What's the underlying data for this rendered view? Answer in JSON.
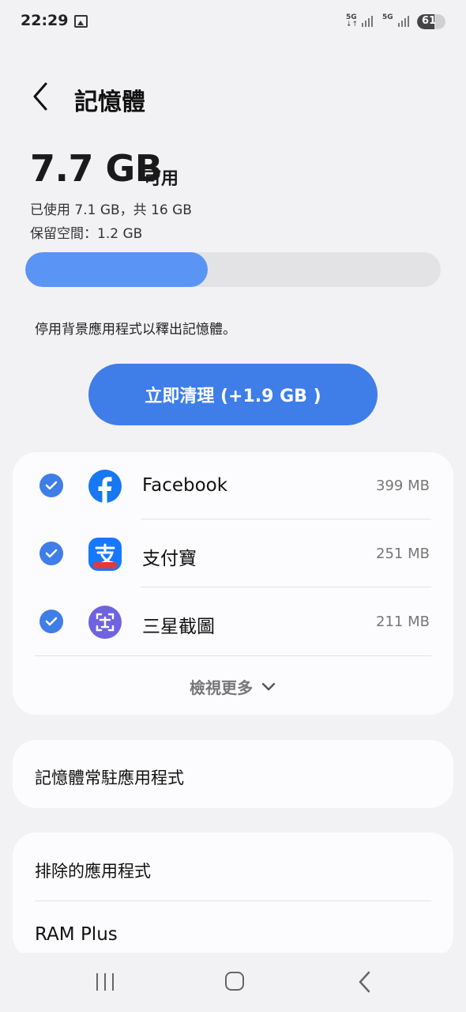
{
  "status_bar": {
    "time": "22:29",
    "network1": "5G",
    "network1_arrows": "↓↑",
    "network2": "5G",
    "battery": "61",
    "battery_level": 0.61,
    "icons": [
      "image-icon",
      "signal-icon",
      "signal-icon",
      "battery-icon"
    ]
  },
  "header": {
    "back_icon": "back-chevron-icon",
    "title": "記憶體"
  },
  "memory": {
    "available_value": "7.7 GB",
    "available_label": "可用",
    "used_text": "已使用 7.1 GB，共 16 GB",
    "reserved_text": "保留空間：1.2 GB",
    "used_fraction": 0.44,
    "hint": "停用背景應用程式以釋出記憶體。",
    "clean_button": "立即清理 (+1.9 GB )"
  },
  "apps": [
    {
      "name": "Facebook",
      "size": "399 MB",
      "checked": true,
      "icon": "facebook-icon"
    },
    {
      "name": "支付寶",
      "size": "251 MB",
      "checked": true,
      "icon": "alipay-icon"
    },
    {
      "name": "三星截圖",
      "size": "211 MB",
      "checked": true,
      "icon": "samsung-capture-icon"
    }
  ],
  "view_more": "檢視更多",
  "resident_apps": "記憶體常駐應用程式",
  "excluded_apps": "排除的應用程式",
  "ram_plus": "RAM Plus",
  "colors": {
    "accent": "#3f7ee8",
    "bar_fill": "#5a95f5",
    "background": "#f2f2f5",
    "card": "#fcfcfe"
  },
  "nav": {
    "icons": [
      "recent-apps-icon",
      "home-icon",
      "back-icon"
    ]
  }
}
